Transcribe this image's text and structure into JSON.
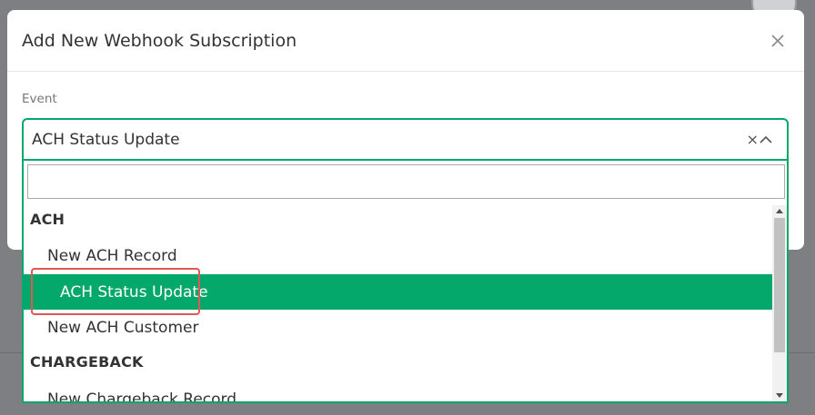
{
  "modal": {
    "title": "Add New Webhook Subscription",
    "close_icon": "close-icon"
  },
  "event_field": {
    "label": "Event",
    "selected_value": "ACH Status Update",
    "search_value": "",
    "clear_glyph": "×"
  },
  "dropdown": {
    "groups": [
      {
        "header": "ACH",
        "options": [
          "New ACH Record",
          "ACH Status Update",
          "New ACH Customer"
        ]
      },
      {
        "header": "CHARGEBACK",
        "options": [
          "New Chargeback Record"
        ]
      }
    ],
    "selected_option": "ACH Status Update"
  },
  "colors": {
    "accent": "#05a86b",
    "highlight_annotation": "#e05555",
    "overlay": "#7d7f83"
  }
}
